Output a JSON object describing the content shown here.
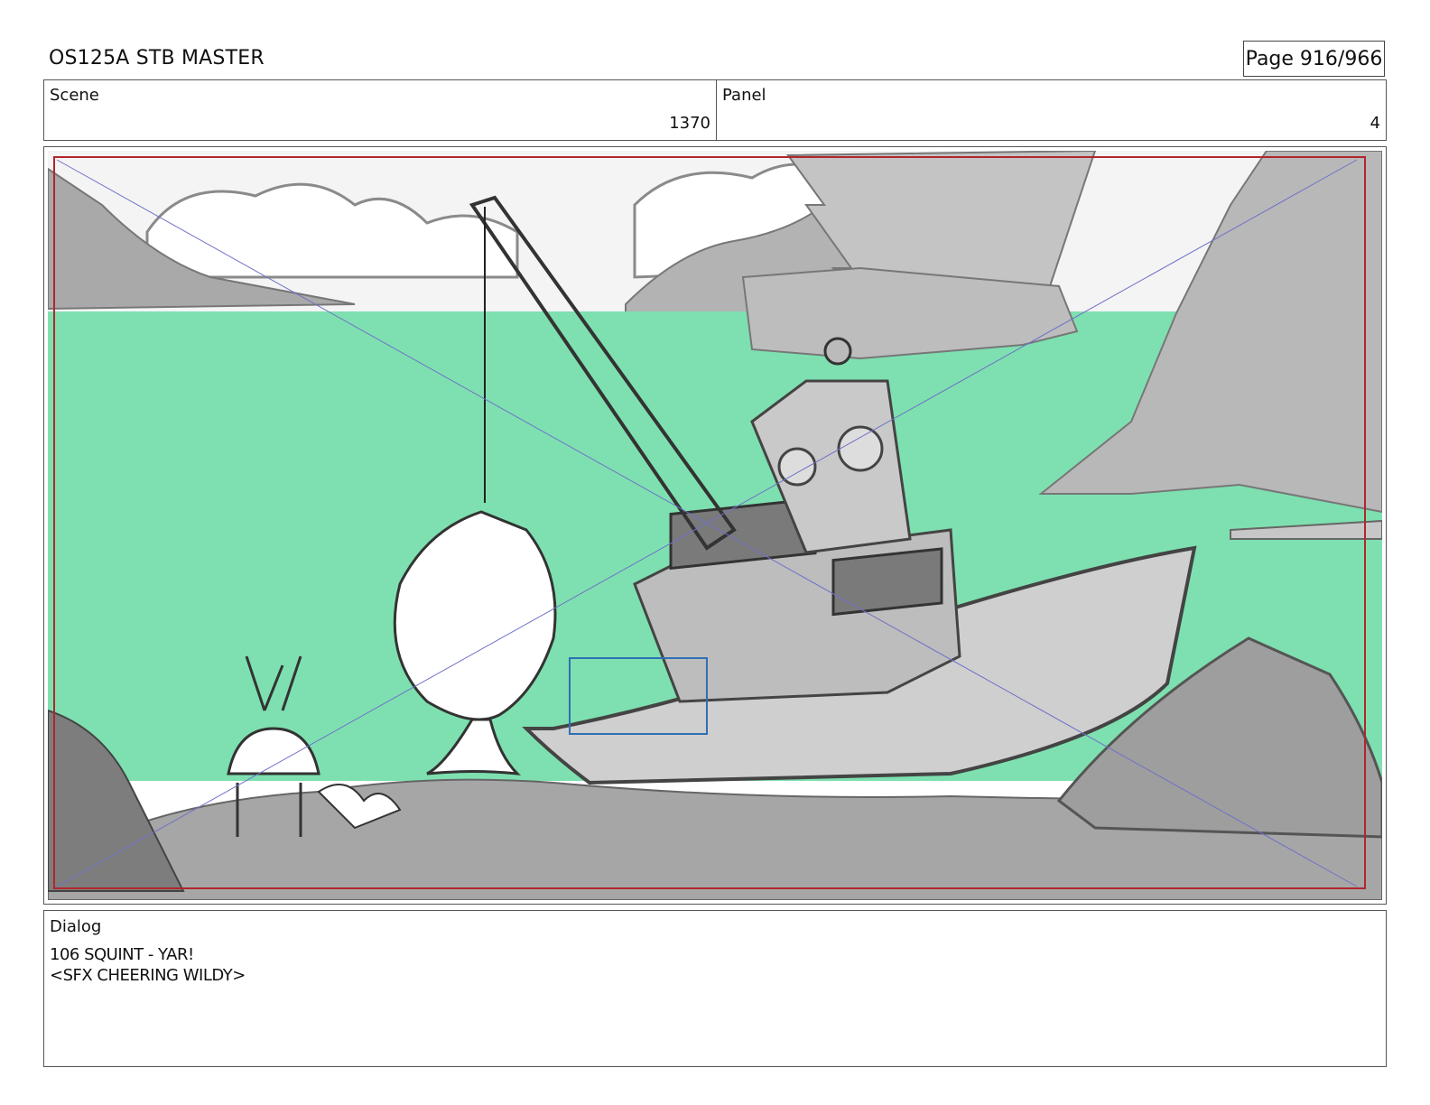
{
  "header": {
    "title": "OS125A STB MASTER",
    "page": "Page 916/966"
  },
  "info": {
    "scene_label": "Scene",
    "scene_value": "1370",
    "panel_label": "Panel",
    "panel_value": "4"
  },
  "frame": {
    "illustration": "storyboard-panel-drawing",
    "colors": {
      "water": "#7ee0b0",
      "safe_frame": "#b0262e",
      "guide_lines": "#6e72c8",
      "focus_box": "#2f6fb5"
    }
  },
  "dialog": {
    "label": "Dialog",
    "lines": [
      "106 SQUINT - YAR!",
      "<SFX CHEERING WILDY>"
    ]
  }
}
